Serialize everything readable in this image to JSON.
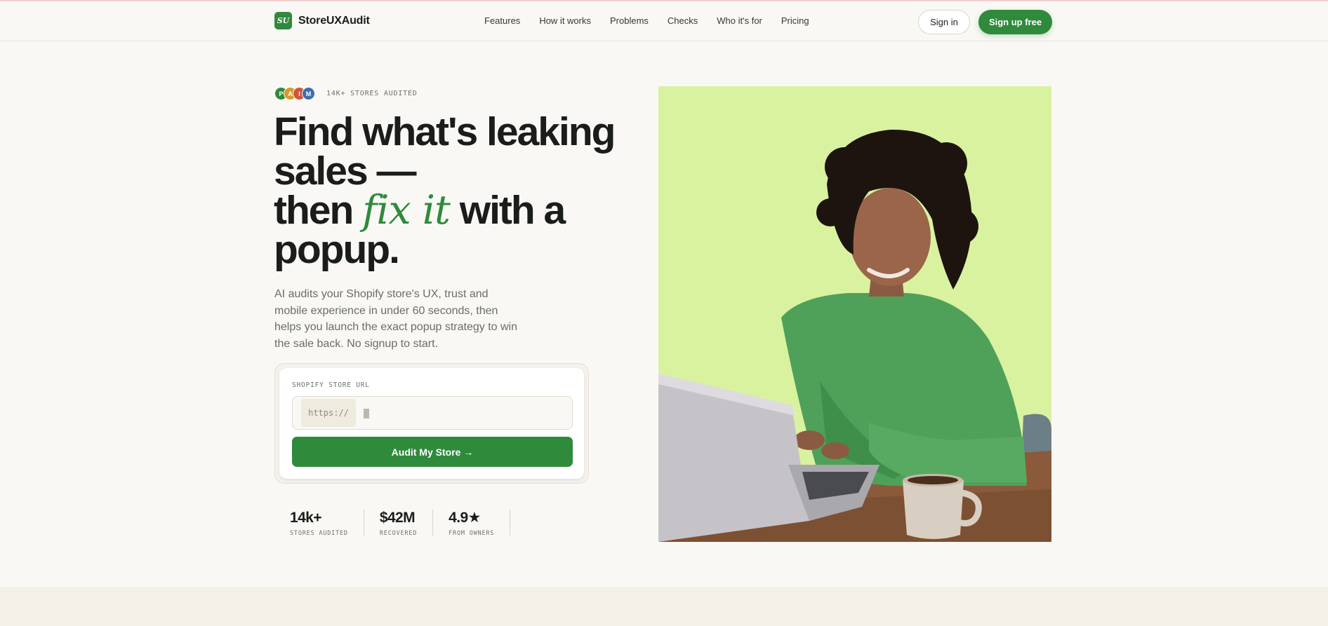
{
  "nav": {
    "brand_mark": "SU",
    "brand_name": "StoreUXAudit",
    "links": [
      "Features",
      "How it works",
      "Problems",
      "Checks",
      "Who it's for",
      "Pricing"
    ],
    "signin_label": "Sign in",
    "signup_label": "Sign up free"
  },
  "hero": {
    "avatars": [
      {
        "letter": "P",
        "color": "#2f8a3c"
      },
      {
        "letter": "A",
        "color": "#d89a2b"
      },
      {
        "letter": "I",
        "color": "#d2553a"
      },
      {
        "letter": "M",
        "color": "#3d6fb0"
      }
    ],
    "eyebrow": "14K+ STORES AUDITED",
    "headline": {
      "line1": "Find what's leaking",
      "line2": "sales —",
      "line3_pre": "then ",
      "line3_accent": "fix it",
      "line3_post": " with a",
      "line4": "popup."
    },
    "subtext": "AI audits your Shopify store's UX, trust and mobile experience in under 60 seconds, then helps you launch the exact popup strategy to win the sale back. No signup to start."
  },
  "form": {
    "label": "SHOPIFY STORE URL",
    "prefix": "https://",
    "input_value": "",
    "button_label": "Audit My Store →"
  },
  "stats": [
    {
      "value": "14k+",
      "label": "STORES AUDITED"
    },
    {
      "value": "$42M",
      "label": "RECOVERED"
    },
    {
      "value": "4.9★",
      "label": "FROM OWNERS"
    }
  ],
  "colors": {
    "accent": "#2f8a3c",
    "background": "#faf8f4",
    "hero_image_bg": "#d9f2a0"
  }
}
